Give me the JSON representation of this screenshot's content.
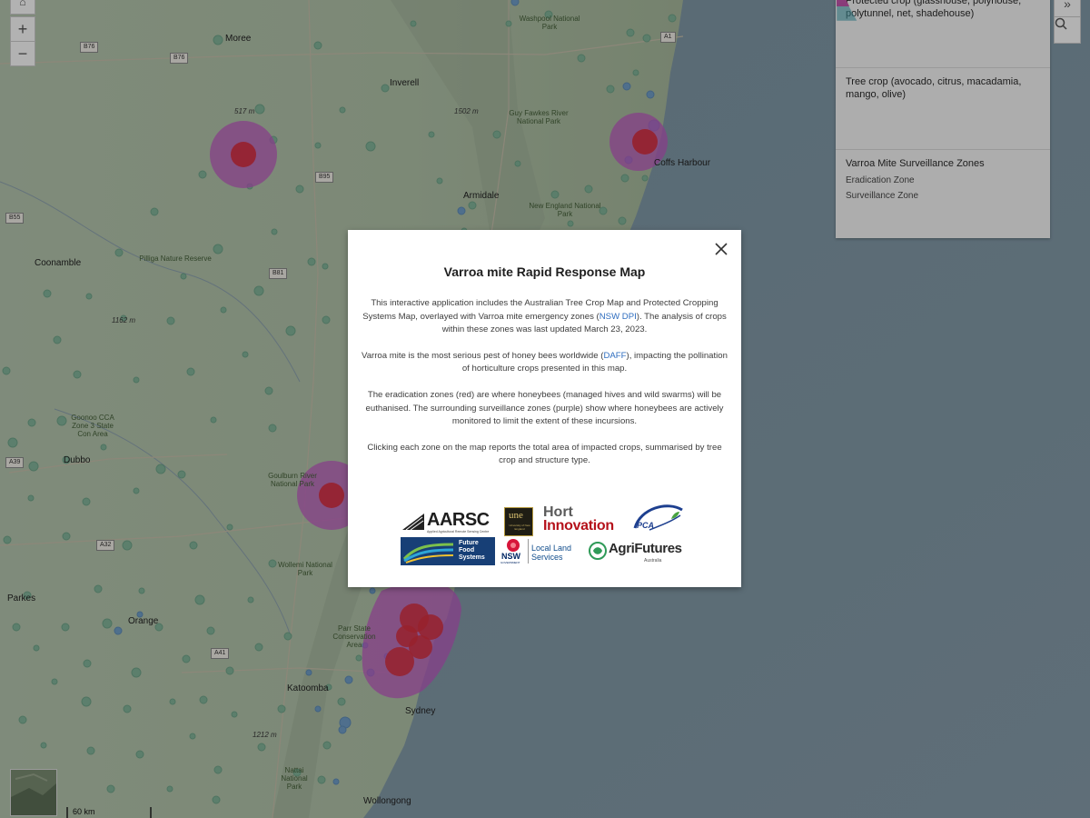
{
  "map": {
    "places": {
      "moree": "Moree",
      "inverell": "Inverell",
      "armidale": "Armidale",
      "coffs_harbour": "Coffs Harbour",
      "coonamble": "Coonamble",
      "dubbo": "Dubbo",
      "orange": "Orange",
      "parkes": "Parkes",
      "katoomba": "Katoomba",
      "sydney": "Sydney",
      "wollongong": "Wollongong"
    },
    "parks": {
      "washpool": "Washpool National Park",
      "guy_fawkes": "Guy Fawkes River National Park",
      "new_england": "New England National Park",
      "pilliga": "Pilliga Nature Reserve",
      "goonoo": "Goonoo CCA Zone 3 State Con Area",
      "goulburn_river": "Goulburn River National Park",
      "wollemi": "Wollemi National Park",
      "parr": "Parr State Conservation Area",
      "nattai": "Nattai National Park"
    },
    "elevations": {
      "e517": "517 m",
      "e1502": "1502 m",
      "e1162": "1162 m",
      "e1212": "1212 m"
    },
    "shields": {
      "b76a": "B76",
      "b76b": "B76",
      "b95": "B95",
      "b55": "B55",
      "a32": "A32",
      "a1": "A1",
      "b81": "B81",
      "a39": "A39",
      "a41": "A41"
    },
    "scale_label": "60 km"
  },
  "controls": {
    "zoom_in": "+",
    "zoom_out": "−"
  },
  "legend": {
    "protected_crop_title": "Protected crop (glasshouse, polyhouse, polytunnel, net, shadehouse)",
    "tree_crop_title": "Tree crop (avocado, citrus, macadamia, mango, olive)",
    "zones_title": "Varroa Mite Surveillance Zones",
    "eradication_label": "Eradication Zone",
    "surveillance_label": "Surveillance Zone"
  },
  "modal": {
    "title": "Varroa mite Rapid Response Map",
    "p1_before": "This interactive application includes the Australian Tree Crop Map and Protected Cropping Systems Map, overlayed with Varroa mite emergency zones (",
    "p1_link": "NSW DPI",
    "p1_after": "). The analysis of crops within these zones was last updated March 23, 2023.",
    "p2_before": "Varroa mite is the most serious pest of honey bees worldwide (",
    "p2_link": "DAFF",
    "p2_after": "), impacting the pollination of horticulture crops presented in this map.",
    "p3": "The eradication zones (red) are where honeybees (managed hives and wild swarms) will be euthanised. The surrounding surveillance zones (purple) show where honeybees are actively monitored to limit the extent of these incursions.",
    "p4": "Clicking each zone on the map reports the total area of impacted crops, summarised by tree crop and structure type.",
    "logos": {
      "aarsc": "AARSC",
      "aarsc_sub": "Applied Agricultural Remote Sensing Centre",
      "une": "une",
      "une_sub": "University of New England",
      "hort": "Hort",
      "innovation": "Innovation",
      "pca": "PCA",
      "future_food_1": "Future",
      "future_food_2": "Food",
      "future_food_3": "Systems",
      "nsw": "NSW",
      "nsw_sub": "GOVERNMENT",
      "local_land_1": "Local Land",
      "local_land_2": "Services",
      "agrifutures": "AgriFutures",
      "agrifutures_sub": "Australia"
    }
  },
  "colors": {
    "eradication": "#d8303f",
    "surveillance": "#c05bc4",
    "protected_crop": "#4c8ede",
    "tree_crop": "#3db898",
    "link": "#2e6dbf"
  }
}
